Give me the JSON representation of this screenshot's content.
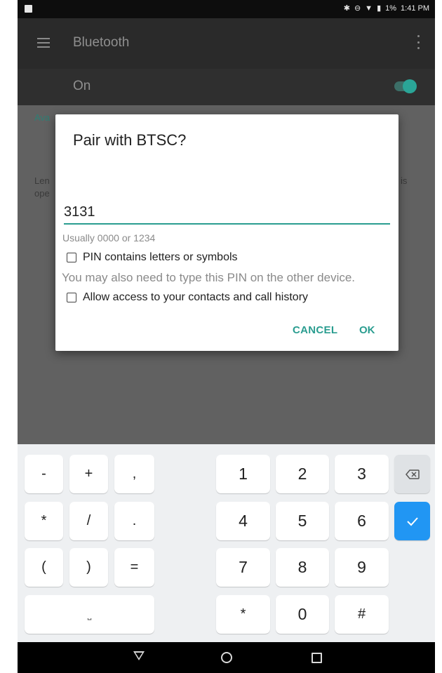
{
  "status_bar": {
    "battery": "1%",
    "time": "1:41 PM",
    "icons": [
      "notification-icon",
      "bluetooth-icon",
      "do-not-disturb-icon",
      "wifi-icon",
      "battery-icon"
    ]
  },
  "app_bar": {
    "title": "Bluetooth",
    "menu_icon": "hamburger-menu-icon",
    "overflow_icon": "overflow-menu-icon"
  },
  "bluetooth_toggle": {
    "label": "On",
    "state": "on",
    "accent": "#2aa597"
  },
  "background_content": {
    "available_header": "Ava",
    "text_line1": "Len",
    "text_line2": "ope",
    "text_right": "is"
  },
  "dialog": {
    "title": "Pair with BTSC?",
    "pin_value": "3131",
    "hint": "Usually 0000 or 1234",
    "checkbox_letters_label": "PIN contains letters or symbols",
    "checkbox_letters_checked": false,
    "note": "You may also need to type this PIN on the other device.",
    "checkbox_contacts_label": "Allow access to your contacts and call history",
    "checkbox_contacts_checked": false,
    "cancel_label": "CANCEL",
    "ok_label": "OK",
    "accent": "#2a9d90"
  },
  "keyboard": {
    "row1": [
      "-",
      "+",
      ",",
      "1",
      "2",
      "3"
    ],
    "row2": [
      "*",
      "/",
      ".",
      "4",
      "5",
      "6"
    ],
    "row3": [
      "(",
      ")",
      "=",
      "7",
      "8",
      "9"
    ],
    "row4": [
      "⎵",
      "*",
      "0",
      "#"
    ],
    "backspace_icon": "backspace-icon",
    "enter_icon": "checkmark-icon",
    "enter_color": "#2196f3"
  },
  "nav_bar": {
    "icons": [
      "back-icon",
      "home-icon",
      "recents-icon"
    ]
  }
}
